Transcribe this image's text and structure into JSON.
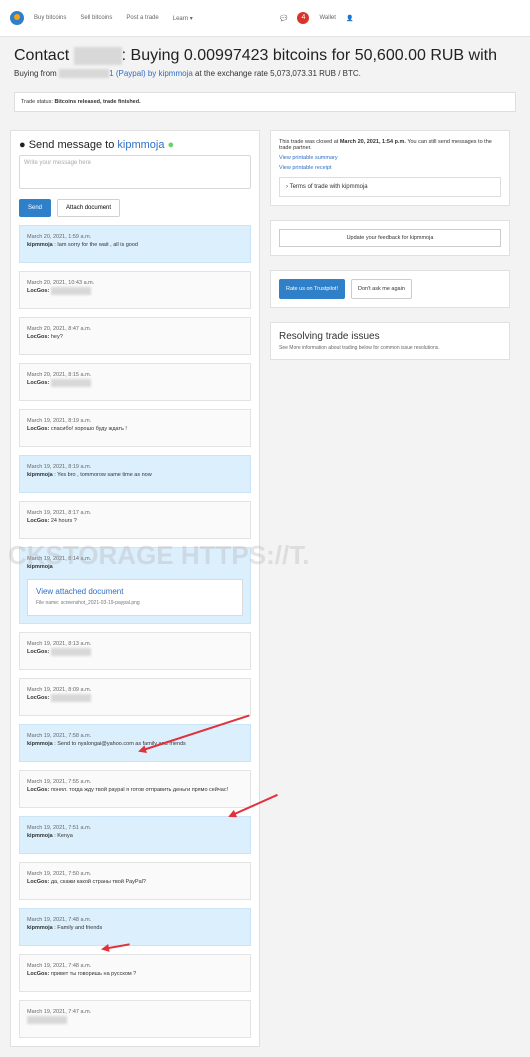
{
  "nav": {
    "links": [
      "Buy bitcoins",
      "Sell bitcoins",
      "Post a trade",
      "Learn ▾"
    ],
    "notification_count": "4",
    "wallet": "Wallet",
    "user_icon": "user-icon"
  },
  "header": {
    "title_prefix": "Contact",
    "title_suffix": ": Buying 0.00997423 bitcoins for 50,600.00 RUB with",
    "buying_from": "Buying from",
    "trader_link": "1 (Paypal) by",
    "user_link": "kipmmoja",
    "exchange": "at the exchange rate 5,073,073.31 RUB / BTC."
  },
  "status": {
    "label": "Trade status:",
    "value": "Bitcoins released, trade finished."
  },
  "message": {
    "title": "Send message to",
    "user": "kipmmoja",
    "placeholder": "Write your message here",
    "send": "Send",
    "attach": "Attach document"
  },
  "messages": [
    {
      "time": "March 20, 2021, 1:59 a.m.",
      "author": "kipmmoja",
      "text": ": Iam sorry for the wait , all is good",
      "blue": true
    },
    {
      "time": "March 20, 2021, 10:43 a.m.",
      "author": "LocGos:",
      "text": "",
      "blue": false
    },
    {
      "time": "March 20, 2021, 8:47 a.m.",
      "author": "LocGos:",
      "text": "hey?",
      "blue": false
    },
    {
      "time": "March 20, 2021, 8:15 a.m.",
      "author": "LocGos:",
      "text": "",
      "blue": false
    },
    {
      "time": "March 19, 2021, 8:19 a.m.",
      "author": "LocGos:",
      "text": "спасибо! хорошо буду ждать !",
      "blue": false
    },
    {
      "time": "March 19, 2021, 8:19 a.m.",
      "author": "kipmmoja",
      "text": ": Yes bro , tommorow same time as now",
      "blue": true
    },
    {
      "time": "March 19, 2021, 8:17 a.m.",
      "author": "LocGos:",
      "text": "24 hours ?",
      "blue": false
    }
  ],
  "attachment": {
    "time": "March 19, 2021, 8:14 a.m.",
    "author": "kipmmoja",
    "link": "View attached document",
    "file": "File name: screenshot_2021-03-19-paypal.png"
  },
  "messages2": [
    {
      "time": "March 19, 2021, 8:13 a.m.",
      "author": "LocGos:",
      "text": "",
      "blue": false
    },
    {
      "time": "March 19, 2021, 8:09 a.m.",
      "author": "LocGos:",
      "text": "",
      "blue": false
    },
    {
      "time": "March 19, 2021, 7:58 a.m.",
      "author": "kipmmoja",
      "text": ": Send to nyalongai@yahoo.com as family and friends",
      "blue": true
    },
    {
      "time": "March 19, 2021, 7:55 a.m.",
      "author": "LocGos:",
      "text": "понял. тогда жду твой paypal я готов отправить деньги прямо сейчас!",
      "blue": false
    },
    {
      "time": "March 19, 2021, 7:51 a.m.",
      "author": "kipmmoja",
      "text": ": Kenya",
      "blue": true
    },
    {
      "time": "March 19, 2021, 7:50 a.m.",
      "author": "LocGos:",
      "text": "да, скажи какой страны твой PayPal?",
      "blue": false
    },
    {
      "time": "March 19, 2021, 7:48 a.m.",
      "author": "kipmmoja",
      "text": ": Family and friends",
      "blue": true
    },
    {
      "time": "March 19, 2021, 7:48 a.m.",
      "author": "LocGos:",
      "text": "привет ты говоришь на русском ?",
      "blue": false
    },
    {
      "time": "March 19, 2021, 7:47 a.m.",
      "author": "",
      "text": "",
      "blue": false
    }
  ],
  "right": {
    "closed": "This trade was closed at",
    "closed_date": "March 20, 2021, 1:54 p.m.",
    "closed_rest": "You can still send messages to the trade partner.",
    "printable_summary": "View printable summary",
    "printable_receipt": "View printable receipt",
    "terms": "Terms of trade with kipmmoja",
    "feedback": "Update your feedback for kipmmoja",
    "rate": "Rate us on Trustpilot!",
    "dont_ask": "Don't ask me again",
    "issues_title": "Resolving trade issues",
    "issues_sub": "See More information about trading below for common issue resolutions."
  },
  "watermark": "CKSTORAGE HTTPS://T."
}
